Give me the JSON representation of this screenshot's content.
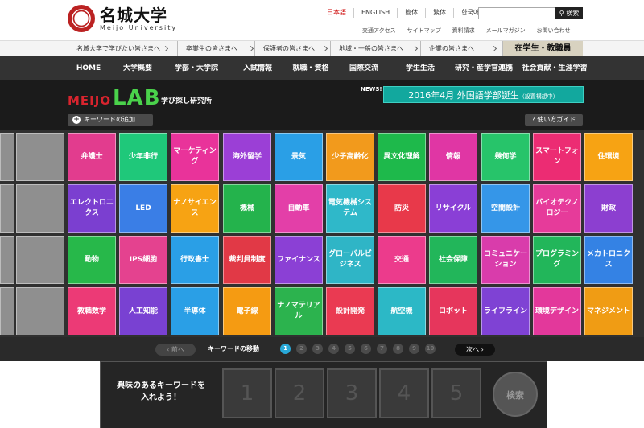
{
  "header": {
    "logo_jp": "名城大学",
    "logo_en": "Meijo University",
    "langs": [
      "日本語",
      "ENGLISH",
      "簡体",
      "繁体",
      "한국어"
    ],
    "search_button": "検索",
    "util_links": [
      "交通アクセス",
      "サイトマップ",
      "資料請求",
      "メールマガジン",
      "お問い合わせ"
    ]
  },
  "audience": [
    "名城大学で学びたい皆さまへ",
    "卒業生の皆さまへ",
    "保護者の皆さまへ",
    "地域・一般の皆さまへ",
    "企業の皆さまへ",
    "在学生・教職員"
  ],
  "nav": [
    "HOME",
    "大学概要",
    "学部・大学院",
    "入試情報",
    "就職・資格",
    "国際交流",
    "学生生活",
    "研究・産学官連携",
    "社会貢献・生涯学習"
  ],
  "lab": {
    "meijo": "MEIJO",
    "lab": "LAB",
    "tagline": "学び探し研究所",
    "news_label": "NEWS!",
    "news": "2016年4月 外国語学部誕生",
    "news_note": "（設置構想中）",
    "add_keyword": "キーワードの追加",
    "guide": "? 使い方ガイド"
  },
  "tiles": [
    [
      "弁護士",
      "少年非行",
      "マーケティング",
      "海外留学",
      "景気",
      "少子高齢化",
      "異文化理解",
      "情報",
      "幾何学",
      "スマートフォン",
      "住環境"
    ],
    [
      "エレクトロニクス",
      "LED",
      "ナノサイエンス",
      "機械",
      "自動車",
      "電気機械システム",
      "防災",
      "リサイクル",
      "空間設計",
      "バイオテクノロジー",
      "財政"
    ],
    [
      "動物",
      "IPS細胞",
      "行政書士",
      "裁判員制度",
      "ファイナンス",
      "グローバルビジネス",
      "交通",
      "社会保障",
      "コミュニケーション",
      "プログラミング",
      "メカトロニクス"
    ],
    [
      "教職数学",
      "人工知能",
      "半導体",
      "電子線",
      "ナノマテリアル",
      "設計開発",
      "航空機",
      "ロボット",
      "ライフライン",
      "環境デザイン",
      "マネジメント"
    ]
  ],
  "tile_colors": [
    [
      "#e23c8e",
      "#1fc87a",
      "#e9339a",
      "#9b3fd6",
      "#2a9fe6",
      "#f29a1c",
      "#1eb94b",
      "#e036a4",
      "#27c46a",
      "#ec2c73",
      "#f7a313"
    ],
    [
      "#7b3fd0",
      "#3a7ee6",
      "#f7a313",
      "#24b34c",
      "#e33fa8",
      "#2fb8c9",
      "#e8394a",
      "#8a3fd6",
      "#3596e8",
      "#e63b9a",
      "#8c3fd0"
    ],
    [
      "#27b84a",
      "#e4428f",
      "#2a9fe6",
      "#e13946",
      "#8b40d5",
      "#2fb5c6",
      "#ec3b8c",
      "#22b65a",
      "#d93cab",
      "#22b65a",
      "#3482e4"
    ],
    [
      "#ec3a76",
      "#7941d2",
      "#2a9fe6",
      "#f59b12",
      "#2cb34e",
      "#ea3a52",
      "#2cb8c6",
      "#e6365c",
      "#7f42d4",
      "#e3389b",
      "#f09c14"
    ]
  ],
  "pager": {
    "prev": "前へ",
    "label": "キーワードの移動",
    "pages": [
      "1",
      "2",
      "3",
      "4",
      "5",
      "6",
      "7",
      "8",
      "9",
      "10"
    ],
    "next": "次へ"
  },
  "tray": {
    "prompt_1": "興味のあるキーワードを",
    "prompt_2": "入れよう！",
    "slots": [
      "1",
      "2",
      "3",
      "4",
      "5"
    ],
    "search": "検索"
  }
}
